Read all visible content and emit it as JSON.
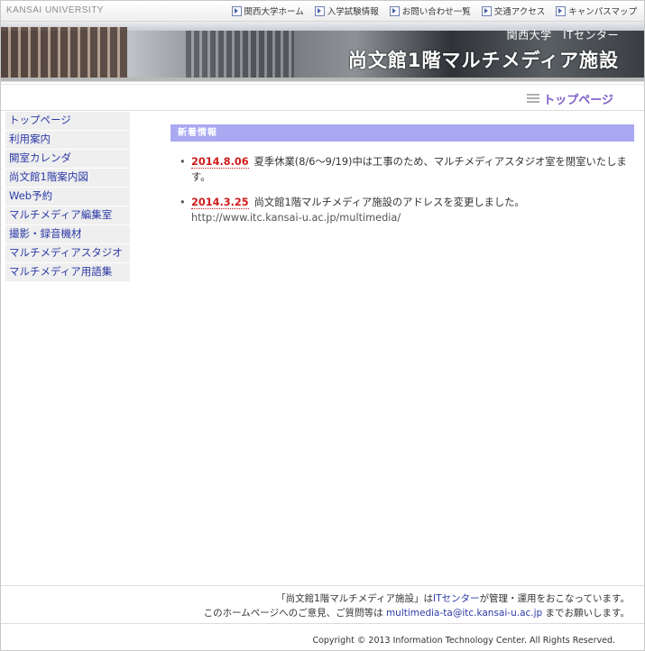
{
  "header": {
    "brand": "KANSAI UNIVERSITY",
    "links": [
      {
        "label": "関西大学ホーム",
        "icon": "arrow-link-icon"
      },
      {
        "label": "入学試験情報",
        "icon": "arrow-link-icon"
      },
      {
        "label": "お問い合わせ一覧",
        "icon": "arrow-link-icon"
      },
      {
        "label": "交通アクセス",
        "icon": "arrow-link-icon"
      },
      {
        "label": "キャンパスマップ",
        "icon": "arrow-link-icon"
      }
    ]
  },
  "banner": {
    "subtitle": "関西大学　ITセンター",
    "title": "尚文館1階マルチメディア施設"
  },
  "page_heading": "トップページ",
  "sidebar": {
    "items": [
      {
        "label": "トップページ"
      },
      {
        "label": "利用案内"
      },
      {
        "label": "開室カレンダ"
      },
      {
        "label": "尚文館1階案内図"
      },
      {
        "label": "Web予約"
      },
      {
        "label": "マルチメディア編集室"
      },
      {
        "label": "撮影・録音機材"
      },
      {
        "label": "マルチメディアスタジオ"
      },
      {
        "label": "マルチメディア用語集"
      }
    ]
  },
  "news": {
    "header": "新着情報",
    "items": [
      {
        "date": "2014.8.06",
        "text": "夏季休業(8/6～9/19)中は工事のため、マルチメディアスタジオ室を閉室いたします。",
        "url": ""
      },
      {
        "date": "2014.3.25",
        "text": "尚文館1階マルチメディア施設のアドレスを変更しました。",
        "url": "http://www.itc.kansai-u.ac.jp/multimedia/"
      }
    ]
  },
  "footer": {
    "line1_pre": "「尚文館1階マルチメディア施設」は",
    "line1_link": "ITセンター",
    "line1_post": "が管理・運用をおこなっています。",
    "line2_pre": "このホームページへのご意見、ご質問等は",
    "line2_link": "multimedia-ta@itc.kansai-u.ac.jp",
    "line2_post": "までお願いします。",
    "copyright": "Copyright © 2013 Information Technology Center. All Rights Reserved."
  },
  "colors": {
    "news_header_bg": "#a9a9f2",
    "date_red": "#d11a1a",
    "link_blue": "#2c3aa6",
    "heading_purple": "#7e5cc7"
  }
}
